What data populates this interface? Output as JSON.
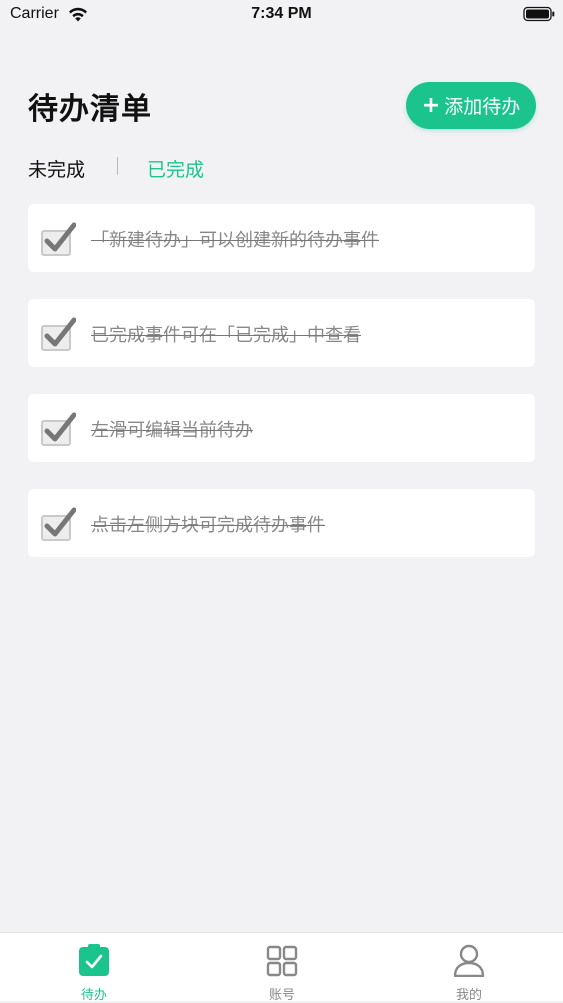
{
  "status_bar": {
    "carrier": "Carrier",
    "time": "7:34 PM"
  },
  "header": {
    "title": "待办清单",
    "add_button_label": "添加待办",
    "add_button_icon": "plus-icon"
  },
  "tabs": {
    "pending_label": "未完成",
    "done_label": "已完成",
    "active": "done"
  },
  "tasks": [
    {
      "text": "「新建待办」可以创建新的待办事件",
      "completed": true
    },
    {
      "text": "已完成事件可在「已完成」中查看",
      "completed": true
    },
    {
      "text": "左滑可编辑当前待办",
      "completed": true
    },
    {
      "text": "点击左侧方块可完成待办事件",
      "completed": true
    }
  ],
  "tab_bar": {
    "items": [
      {
        "label": "待办",
        "icon": "todo-icon",
        "active": true
      },
      {
        "label": "账号",
        "icon": "grid-icon",
        "active": false
      },
      {
        "label": "我的",
        "icon": "person-icon",
        "active": false
      }
    ]
  },
  "colors": {
    "accent": "#1cc48d",
    "background": "#f2f2f5",
    "card": "#ffffff",
    "muted_text": "#888888"
  }
}
